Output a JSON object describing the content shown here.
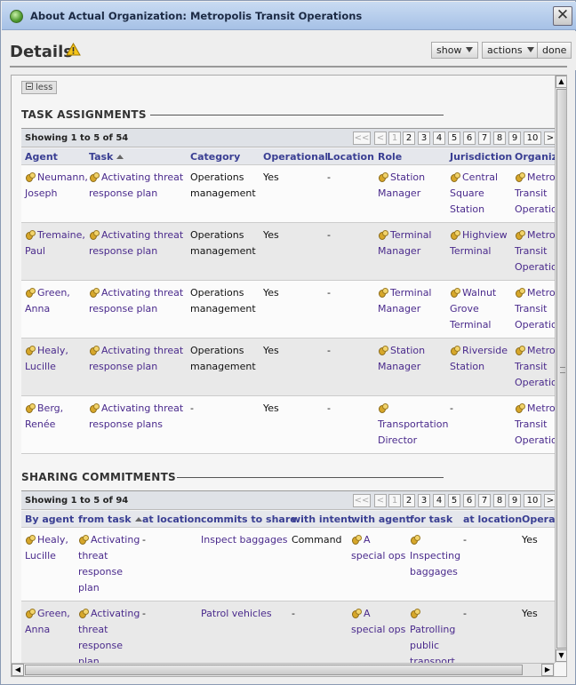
{
  "window": {
    "title": "About Actual Organization: Metropolis Transit Operations"
  },
  "header": {
    "title": "Details",
    "show_label": "show",
    "actions_label": "actions",
    "done_label": "done"
  },
  "less_label": "less",
  "task_section": {
    "heading": "TASK ASSIGNMENTS",
    "showing": "Showing 1 to 5 of 54",
    "pager": [
      "<<",
      "<",
      "1",
      "2",
      "3",
      "4",
      "5",
      "6",
      "7",
      "8",
      "9",
      "10",
      ">"
    ],
    "columns": [
      "Agent",
      "Task",
      "Category",
      "Operational",
      "Location",
      "Role",
      "Jurisdiction",
      "Organiza"
    ],
    "rows": [
      {
        "agent": [
          "Neumann,",
          "Joseph"
        ],
        "task": [
          "Activating threat",
          "response plan"
        ],
        "category": [
          "Operations",
          "management"
        ],
        "operational": "Yes",
        "location": "-",
        "role": [
          "Station",
          "Manager"
        ],
        "jurisdiction": [
          "Central",
          "Square",
          "Station"
        ],
        "org": [
          "Metrop",
          "Transit",
          "Operation"
        ]
      },
      {
        "agent": [
          "Tremaine,",
          "Paul"
        ],
        "task": [
          "Activating threat",
          "response plan"
        ],
        "category": [
          "Operations",
          "management"
        ],
        "operational": "Yes",
        "location": "-",
        "role": [
          "Terminal",
          "Manager"
        ],
        "jurisdiction": [
          "Highview",
          "Terminal"
        ],
        "org": [
          "Metrop",
          "Transit",
          "Operation"
        ]
      },
      {
        "agent": [
          "Green,",
          "Anna"
        ],
        "task": [
          "Activating threat",
          "response plan"
        ],
        "category": [
          "Operations",
          "management"
        ],
        "operational": "Yes",
        "location": "-",
        "role": [
          "Terminal",
          "Manager"
        ],
        "jurisdiction": [
          "Walnut",
          "Grove",
          "Terminal"
        ],
        "org": [
          "Metrop",
          "Transit",
          "Operation"
        ]
      },
      {
        "agent": [
          "Healy,",
          "Lucille"
        ],
        "task": [
          "Activating threat",
          "response plan"
        ],
        "category": [
          "Operations",
          "management"
        ],
        "operational": "Yes",
        "location": "-",
        "role": [
          "Station",
          "Manager"
        ],
        "jurisdiction": [
          "Riverside",
          "Station"
        ],
        "org": [
          "Metrop",
          "Transit",
          "Operation"
        ]
      },
      {
        "agent": [
          "Berg,",
          "Renée"
        ],
        "task": [
          "Activating threat",
          "response plans"
        ],
        "category": [
          "-"
        ],
        "operational": "Yes",
        "location": "-",
        "role": [
          "",
          "Transportation",
          "Director"
        ],
        "jurisdiction": [
          "-"
        ],
        "org": [
          "Metrop",
          "Transit",
          "Operation"
        ]
      }
    ]
  },
  "sharing_section": {
    "heading": "SHARING COMMITMENTS",
    "showing": "Showing 1 to 5 of 94",
    "pager": [
      "<<",
      "<",
      "1",
      "2",
      "3",
      "4",
      "5",
      "6",
      "7",
      "8",
      "9",
      "10",
      ">"
    ],
    "columns": [
      "By agent",
      "from task",
      "at location",
      "commits to share",
      "with intent",
      "with agent",
      "for task",
      "at location",
      "Operat"
    ],
    "rows": [
      {
        "by_agent": [
          "Healy,",
          "Lucille"
        ],
        "from_task": [
          "Activating",
          "threat",
          "response",
          "plan"
        ],
        "at_location": "-",
        "commits": "Inspect baggages",
        "intent": "Command",
        "with_agent": [
          "A",
          "special ops"
        ],
        "for_task": [
          "",
          "Inspecting",
          "baggages"
        ],
        "at_location2": "-",
        "operational": "Yes"
      },
      {
        "by_agent": [
          "Green,",
          "Anna"
        ],
        "from_task": [
          "Activating",
          "threat",
          "response",
          "plan"
        ],
        "at_location": "-",
        "commits": "Patrol vehicles",
        "intent": "-",
        "with_agent": [
          "A",
          "special ops"
        ],
        "for_task": [
          "",
          "Patrolling",
          "public",
          "transport"
        ],
        "at_location2": "-",
        "operational": "Yes"
      }
    ]
  }
}
